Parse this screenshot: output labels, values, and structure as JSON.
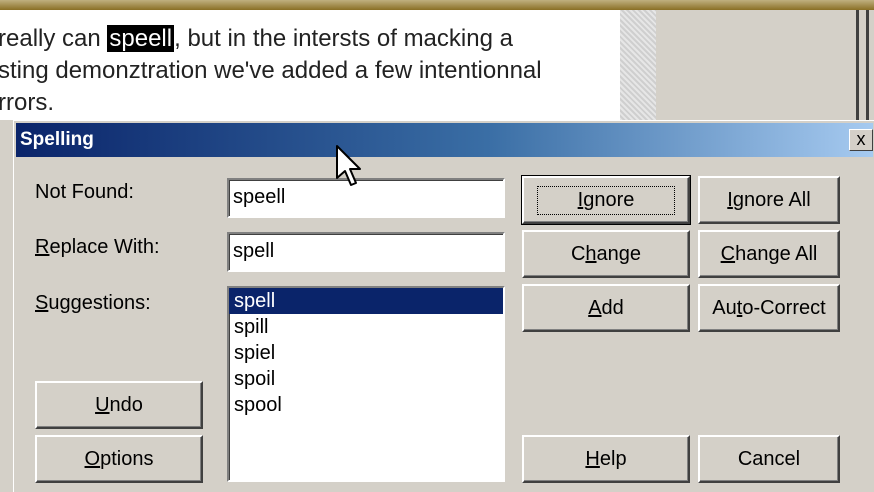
{
  "document": {
    "line1_before": "really can ",
    "line1_highlight": "speell",
    "line1_after": ", but in the intersts of macking a",
    "line2": "sting demonztration we've added a few intentionnal",
    "line3": "rrors."
  },
  "dialog": {
    "title": "Spelling",
    "close_glyph": "x",
    "not_found_label": "Not Found:",
    "not_found_value": "speell",
    "replace_with_label_prefix": "",
    "replace_with_label_accel": "R",
    "replace_with_label_rest": "eplace With:",
    "replace_with_value": "spell",
    "suggestions_label_accel": "S",
    "suggestions_label_rest": "uggestions:",
    "suggestions": [
      "spell",
      "spill",
      "spiel",
      "spoil",
      "spool"
    ],
    "selected_suggestion": "spell"
  },
  "buttons": {
    "ignore": {
      "pre": "",
      "accel": "I",
      "post": "gnore"
    },
    "ignore_all": {
      "pre": "",
      "accel": "I",
      "post": "gnore All"
    },
    "change": {
      "pre": "C",
      "accel": "h",
      "post": "ange"
    },
    "change_all": {
      "pre": "",
      "accel": "C",
      "post": "hange All"
    },
    "add": {
      "pre": "",
      "accel": "A",
      "post": "dd"
    },
    "auto_correct": {
      "pre": "Au",
      "accel": "t",
      "post": "o-Correct"
    },
    "undo": {
      "pre": "",
      "accel": "U",
      "post": "ndo"
    },
    "options": {
      "pre": "",
      "accel": "O",
      "post": "ptions"
    },
    "help": {
      "pre": "",
      "accel": "H",
      "post": "elp"
    },
    "cancel": {
      "pre": "Cancel",
      "accel": "",
      "post": ""
    }
  },
  "colors": {
    "title_gradient_start": "#0a246a",
    "title_gradient_end": "#a6caf0",
    "selection": "#0a246a",
    "face": "#d4d0c8"
  }
}
